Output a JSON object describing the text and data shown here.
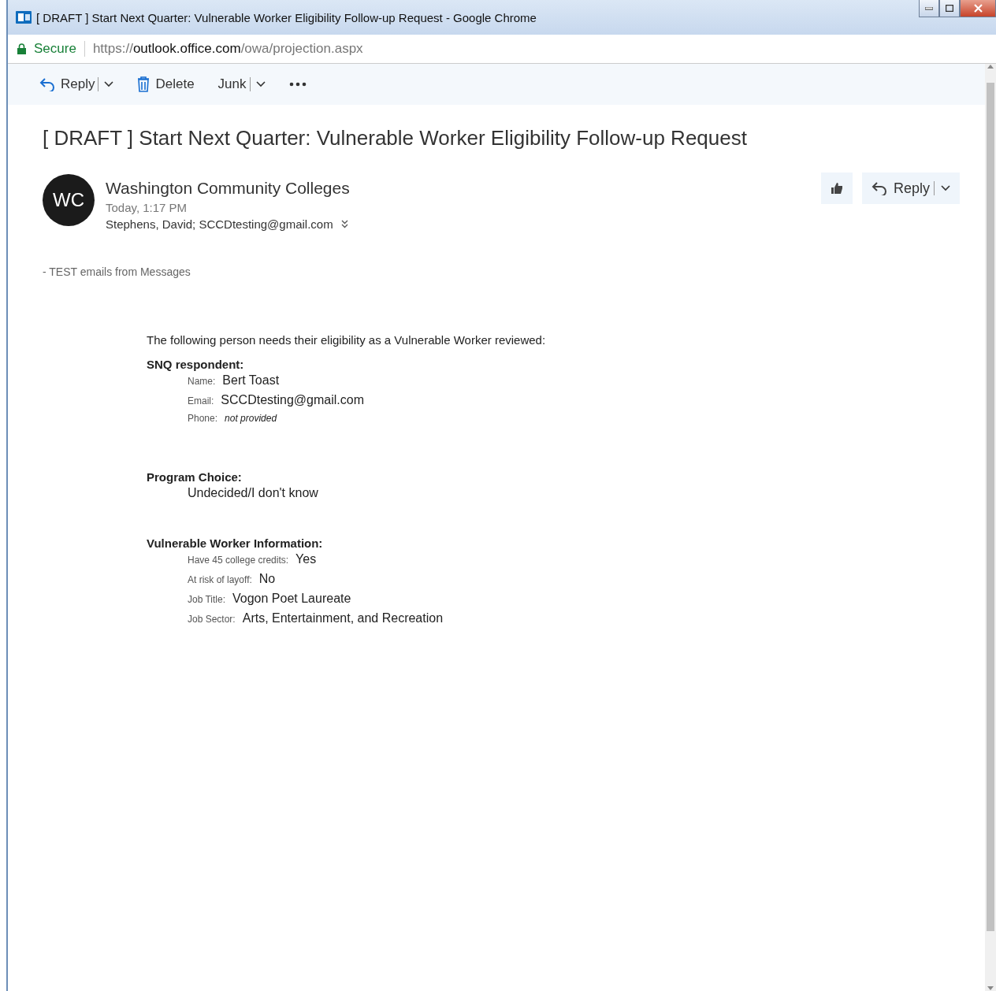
{
  "window": {
    "title": "[ DRAFT ] Start Next Quarter: Vulnerable Worker Eligibility Follow-up Request - Google Chrome"
  },
  "address_bar": {
    "secure_label": "Secure",
    "url": {
      "scheme": "https://",
      "host": "outlook.office.com",
      "path": "/owa/projection.aspx"
    }
  },
  "toolbar": [
    {
      "kind": "reply",
      "label": "Reply"
    },
    {
      "kind": "delete",
      "label": "Delete"
    },
    {
      "kind": "junk",
      "label": "Junk"
    },
    {
      "kind": "more"
    }
  ],
  "subject": "[ DRAFT ] Start Next Quarter: Vulnerable Worker Eligibility Follow-up Request",
  "message": {
    "initials": "WC",
    "sender": "Washington Community Colleges",
    "time": "Today, 1:17 PM",
    "recipients": "Stephens, David; SCCDtesting@gmail.com",
    "actions": [
      {
        "kind": "like"
      },
      {
        "kind": "reply",
        "label": "Reply"
      }
    ]
  },
  "body": {
    "group_note": "- TEST emails from Messages",
    "intro": "The following person needs their eligibility as a Vulnerable Worker reviewed:",
    "sections": [
      {
        "heading": "SNQ respondent:",
        "fields": [
          {
            "label": "Name:",
            "value": "Bert Toast",
            "emphasis": false
          },
          {
            "label": "Email:",
            "value": "SCCDtesting@gmail.com",
            "emphasis": false
          },
          {
            "label": "Phone:",
            "value": "not provided",
            "emphasis": true
          }
        ]
      },
      {
        "heading": "Program Choice:",
        "fields": [
          {
            "value": "Undecided/I don't know",
            "emphasis": false
          }
        ]
      },
      {
        "heading": "Vulnerable Worker Information:",
        "fields": [
          {
            "label": "Have 45 college credits:",
            "value": "Yes",
            "emphasis": false
          },
          {
            "label": "At risk of layoff:",
            "value": "No",
            "emphasis": false
          },
          {
            "label": "Job Title:",
            "value": "Vogon Poet Laureate",
            "emphasis": false
          },
          {
            "label": "Job Sector:",
            "value": "Arts, Entertainment, and Recreation",
            "emphasis": false
          }
        ]
      }
    ]
  }
}
